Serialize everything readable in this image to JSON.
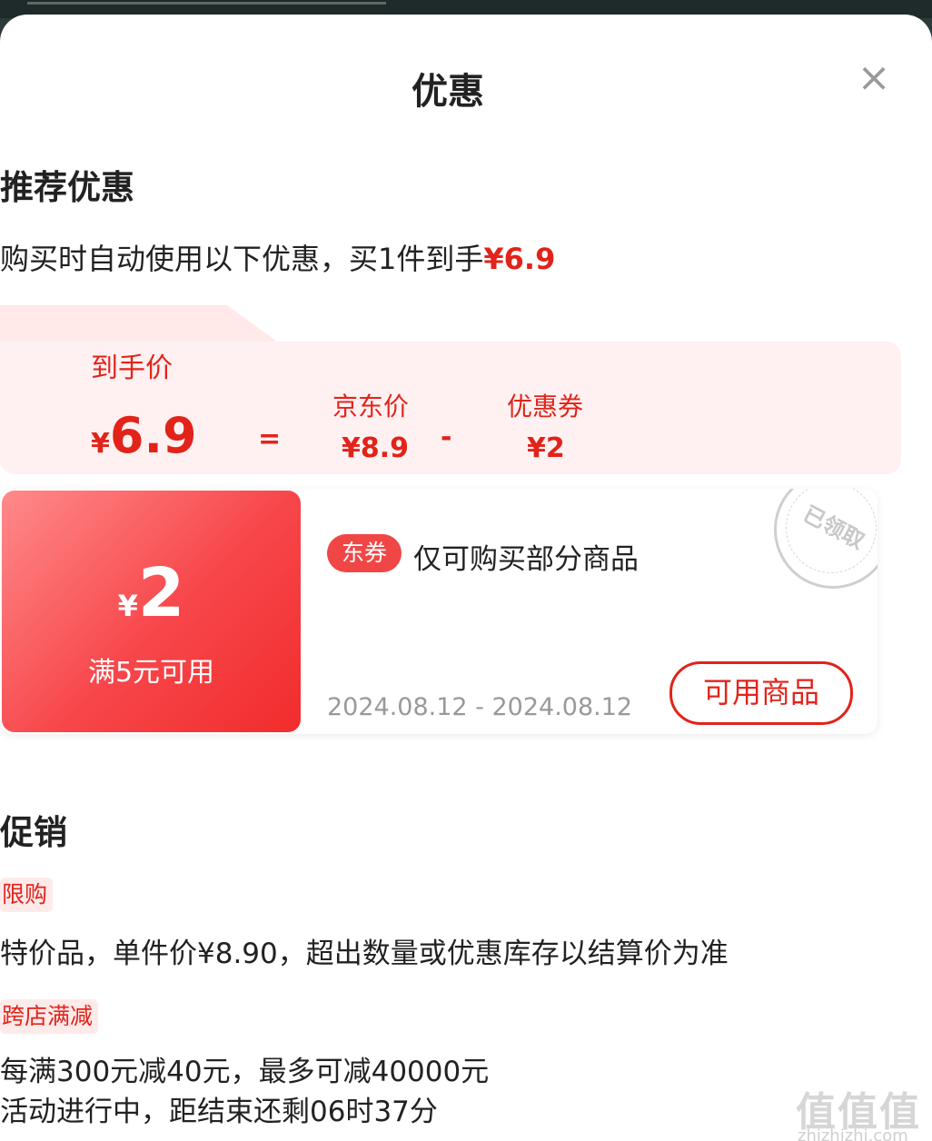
{
  "sheet": {
    "title": "优惠"
  },
  "recommend": {
    "heading": "推荐优惠",
    "subtitle_prefix": "购买时自动使用以下优惠，买1件到手",
    "subtitle_price": "¥6.9"
  },
  "breakdown": {
    "final_label": "到手价",
    "final_currency": "¥",
    "final_value": "6.9",
    "equals": "=",
    "jd_label": "京东价",
    "jd_value": "¥8.9",
    "minus": "-",
    "coupon_label": "优惠券",
    "coupon_value": "¥2"
  },
  "coupon": {
    "currency": "¥",
    "amount": "2",
    "condition": "满5元可用",
    "tag": "东券",
    "description": "仅可购买部分商品",
    "date_range": "2024.08.12 - 2024.08.12",
    "button": "可用商品",
    "stamp": "已领取"
  },
  "promotion": {
    "heading": "促销",
    "items": [
      {
        "badge": "限购",
        "lines": [
          "特价品，单件价¥8.90，超出数量或优惠库存以结算价为准"
        ]
      },
      {
        "badge": "跨店满减",
        "lines": [
          "每满300元减40元，最多可减40000元",
          "活动进行中，距结束还剩06时37分"
        ]
      }
    ]
  },
  "watermark": {
    "logo": "值值值",
    "site": "zhizhizhi.com"
  },
  "colors": {
    "accent": "#e2231a",
    "coupon_gradient_start": "#ff8a8a",
    "coupon_gradient_end": "#f12c2c",
    "panel_bg": "#fff1f1"
  }
}
